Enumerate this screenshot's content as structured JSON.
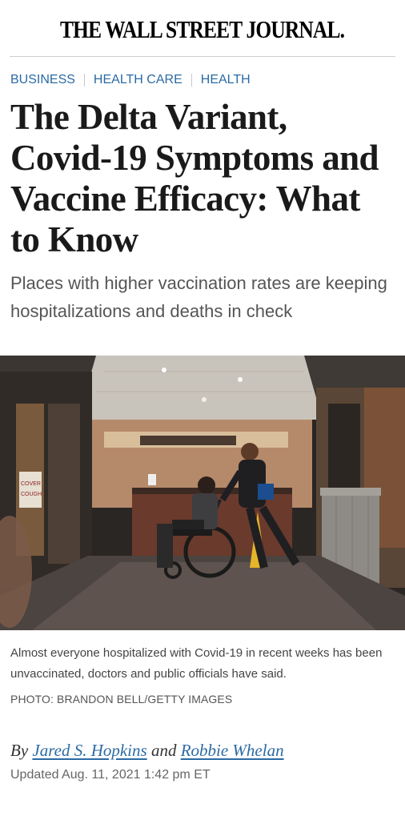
{
  "masthead": {
    "logo_text": "THE WALL STREET JOURNAL."
  },
  "breadcrumb": [
    "BUSINESS",
    "HEALTH CARE",
    "HEALTH"
  ],
  "article": {
    "headline": "The Delta Variant, Covid-19 Symptoms and Vaccine Efficacy: What to Know",
    "dek": "Places with higher vaccination rates are keeping hospitalizations and deaths in check",
    "image": {
      "caption": "Almost everyone hospitalized with Covid-19 in recent weeks has been unvaccinated, doctors and public officials have said.",
      "credit": "PHOTO: BRANDON BELL/GETTY IMAGES",
      "sign_text": "COVER YOUR COUGH"
    },
    "byline": {
      "prefix": "By",
      "author1": "Jared S. Hopkins",
      "conjunction": "and",
      "author2": "Robbie Whelan"
    },
    "timestamp": "Updated Aug. 11, 2021 1:42 pm ET"
  },
  "colors": {
    "link": "#2b6aa3",
    "headline": "#1a1a1a",
    "dek": "#555555"
  }
}
